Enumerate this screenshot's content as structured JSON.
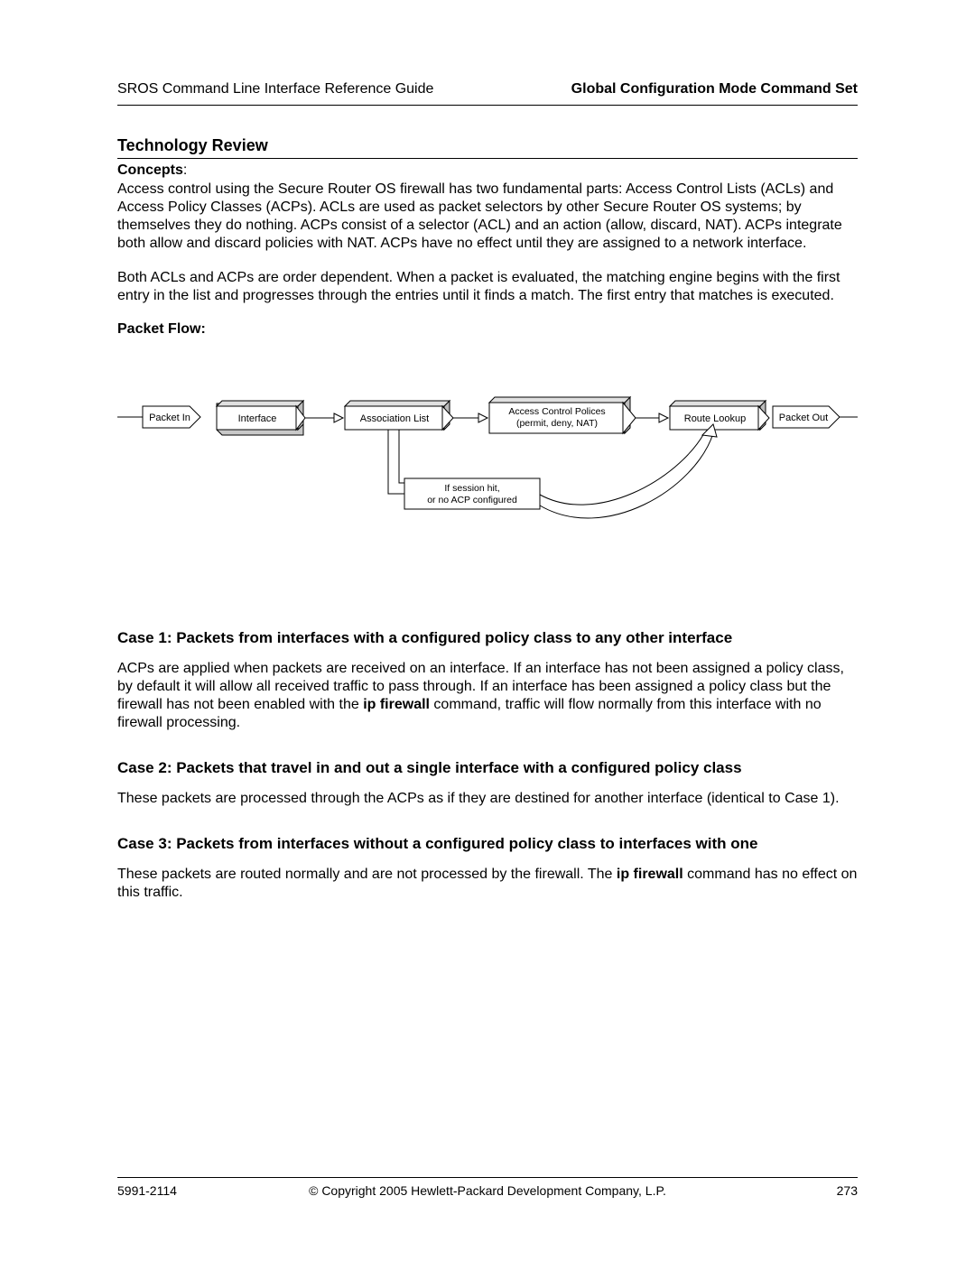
{
  "header": {
    "left": "SROS Command Line Interface Reference Guide",
    "right": "Global Configuration Mode Command Set"
  },
  "tech_review": "Technology Review",
  "concepts_label": "Concepts",
  "concepts_colon": ":",
  "concepts_p1": "Access control using the Secure Router OS firewall has two fundamental parts: Access Control Lists (ACLs) and Access Policy Classes (ACPs). ACLs are used as packet selectors by other Secure Router OS systems; by themselves they do nothing. ACPs consist of a selector (ACL) and an action (allow, discard, NAT). ACPs integrate both allow and discard policies with NAT. ACPs have no effect until they are assigned to a network interface.",
  "concepts_p2": "Both ACLs and ACPs are order dependent. When a packet is evaluated, the matching engine begins with the first entry in the list and progresses through the entries until it finds a match. The first entry that matches is executed.",
  "packet_flow_label": "Packet Flow:",
  "diagram": {
    "packet_in": "Packet In",
    "interface": "Interface",
    "assoc_list": "Association List",
    "acp_line1": "Access Control Polices",
    "acp_line2": "(permit, deny, NAT)",
    "route_lookup": "Route Lookup",
    "packet_out": "Packet Out",
    "session_line1": "If session hit,",
    "session_line2": "or no ACP configured"
  },
  "case1_head": "Case 1: Packets from interfaces with a configured policy class to any other interface",
  "case1_pre": "ACPs are applied when packets are received on an interface. If an interface has not been assigned a policy class, by default it will allow all received traffic to pass through. If an interface has been assigned a policy class but the firewall has not been enabled with the ",
  "case1_bold": "ip firewall",
  "case1_post": " command, traffic will flow normally from this interface with no firewall processing.",
  "case2_head": "Case 2: Packets that travel in and out a single interface with a configured policy class",
  "case2_body": "These packets are processed through the ACPs as if they are destined for another interface (identical to Case 1).",
  "case3_head": "Case 3: Packets from interfaces without a configured policy class to interfaces with one",
  "case3_pre": "These packets are routed normally and are not processed by the firewall. The ",
  "case3_bold": "ip firewall",
  "case3_post": " command has no effect on this traffic.",
  "footer": {
    "left": "5991-2114",
    "center": "© Copyright 2005 Hewlett-Packard Development Company, L.P.",
    "right": "273"
  }
}
